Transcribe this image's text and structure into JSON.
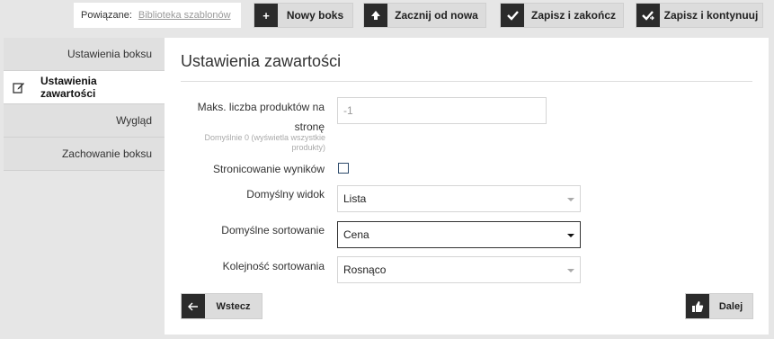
{
  "toolbar": {
    "related_label": "Powiązane:",
    "related_link": "Biblioteka szablonów",
    "new_box": "Nowy boks",
    "restart": "Zacznij od nowa",
    "save_finish": "Zapisz i zakończ",
    "save_continue": "Zapisz i kontynuuj"
  },
  "sidebar": {
    "items": [
      {
        "label": "Ustawienia boksu"
      },
      {
        "label": "Ustawienia zawartości"
      },
      {
        "label": "Wygląd"
      },
      {
        "label": "Zachowanie boksu"
      }
    ]
  },
  "main": {
    "title": "Ustawienia zawartości",
    "max_products_label_1": "Maks. liczba produktów na",
    "max_products_label_2": "stronę",
    "max_products_hint": "Domyślnie 0 (wyświetla wszystkie produkty)",
    "max_products_value": "-1",
    "pagination_label": "Stronicowanie wyników",
    "pagination_checked": false,
    "default_view_label": "Domyślny widok",
    "default_view_value": "Lista",
    "default_sort_label": "Domyślne sortowanie",
    "default_sort_value": "Cena",
    "sort_order_label": "Kolejność sortowania",
    "sort_order_value": "Rosnąco"
  },
  "nav": {
    "back": "Wstecz",
    "next": "Dalej"
  },
  "icons": {
    "new_box": "plus-icon",
    "restart": "arrow-up-icon",
    "save_finish": "check-icon",
    "save_continue": "check-arrow-icon",
    "active_item": "edit-icon",
    "back": "arrow-left-icon",
    "next": "thumbs-up-icon"
  },
  "colors": {
    "icon_bg": "#2b2b2b",
    "button_bg": "#dcdcdc",
    "page_bg": "#e6e6e6",
    "checkbox_border": "#2d4a6b"
  }
}
